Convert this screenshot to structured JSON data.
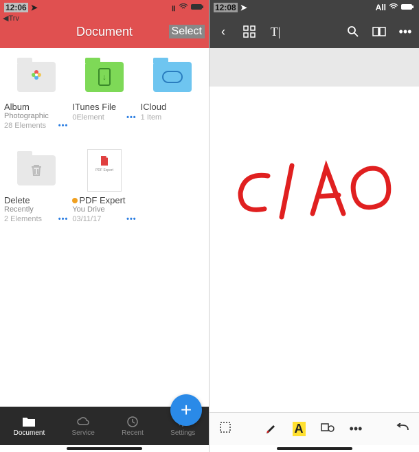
{
  "left": {
    "status": {
      "time": "12:06",
      "location_icon": "location-icon"
    },
    "back_label": "Trv",
    "title": "Document",
    "select_label": "Select",
    "tiles": [
      {
        "name": "Album",
        "sub": "Photographic",
        "count": "28 Elements"
      },
      {
        "name": "ITunes File",
        "sub": "",
        "count": "0Element"
      },
      {
        "name": "ICloud",
        "sub": "",
        "count": "1 Item"
      },
      {
        "name": "Delete",
        "sub": "Recently",
        "count": "2 Elements"
      },
      {
        "name": "PDF Expert",
        "sub": "You Drive",
        "count": "03/11/17"
      }
    ],
    "bottom": {
      "items": [
        "Document",
        "Service",
        "Recent",
        "Settings"
      ]
    }
  },
  "right": {
    "status": {
      "time": "12:08",
      "all": "All"
    },
    "handwritten_text": "CIAO"
  }
}
